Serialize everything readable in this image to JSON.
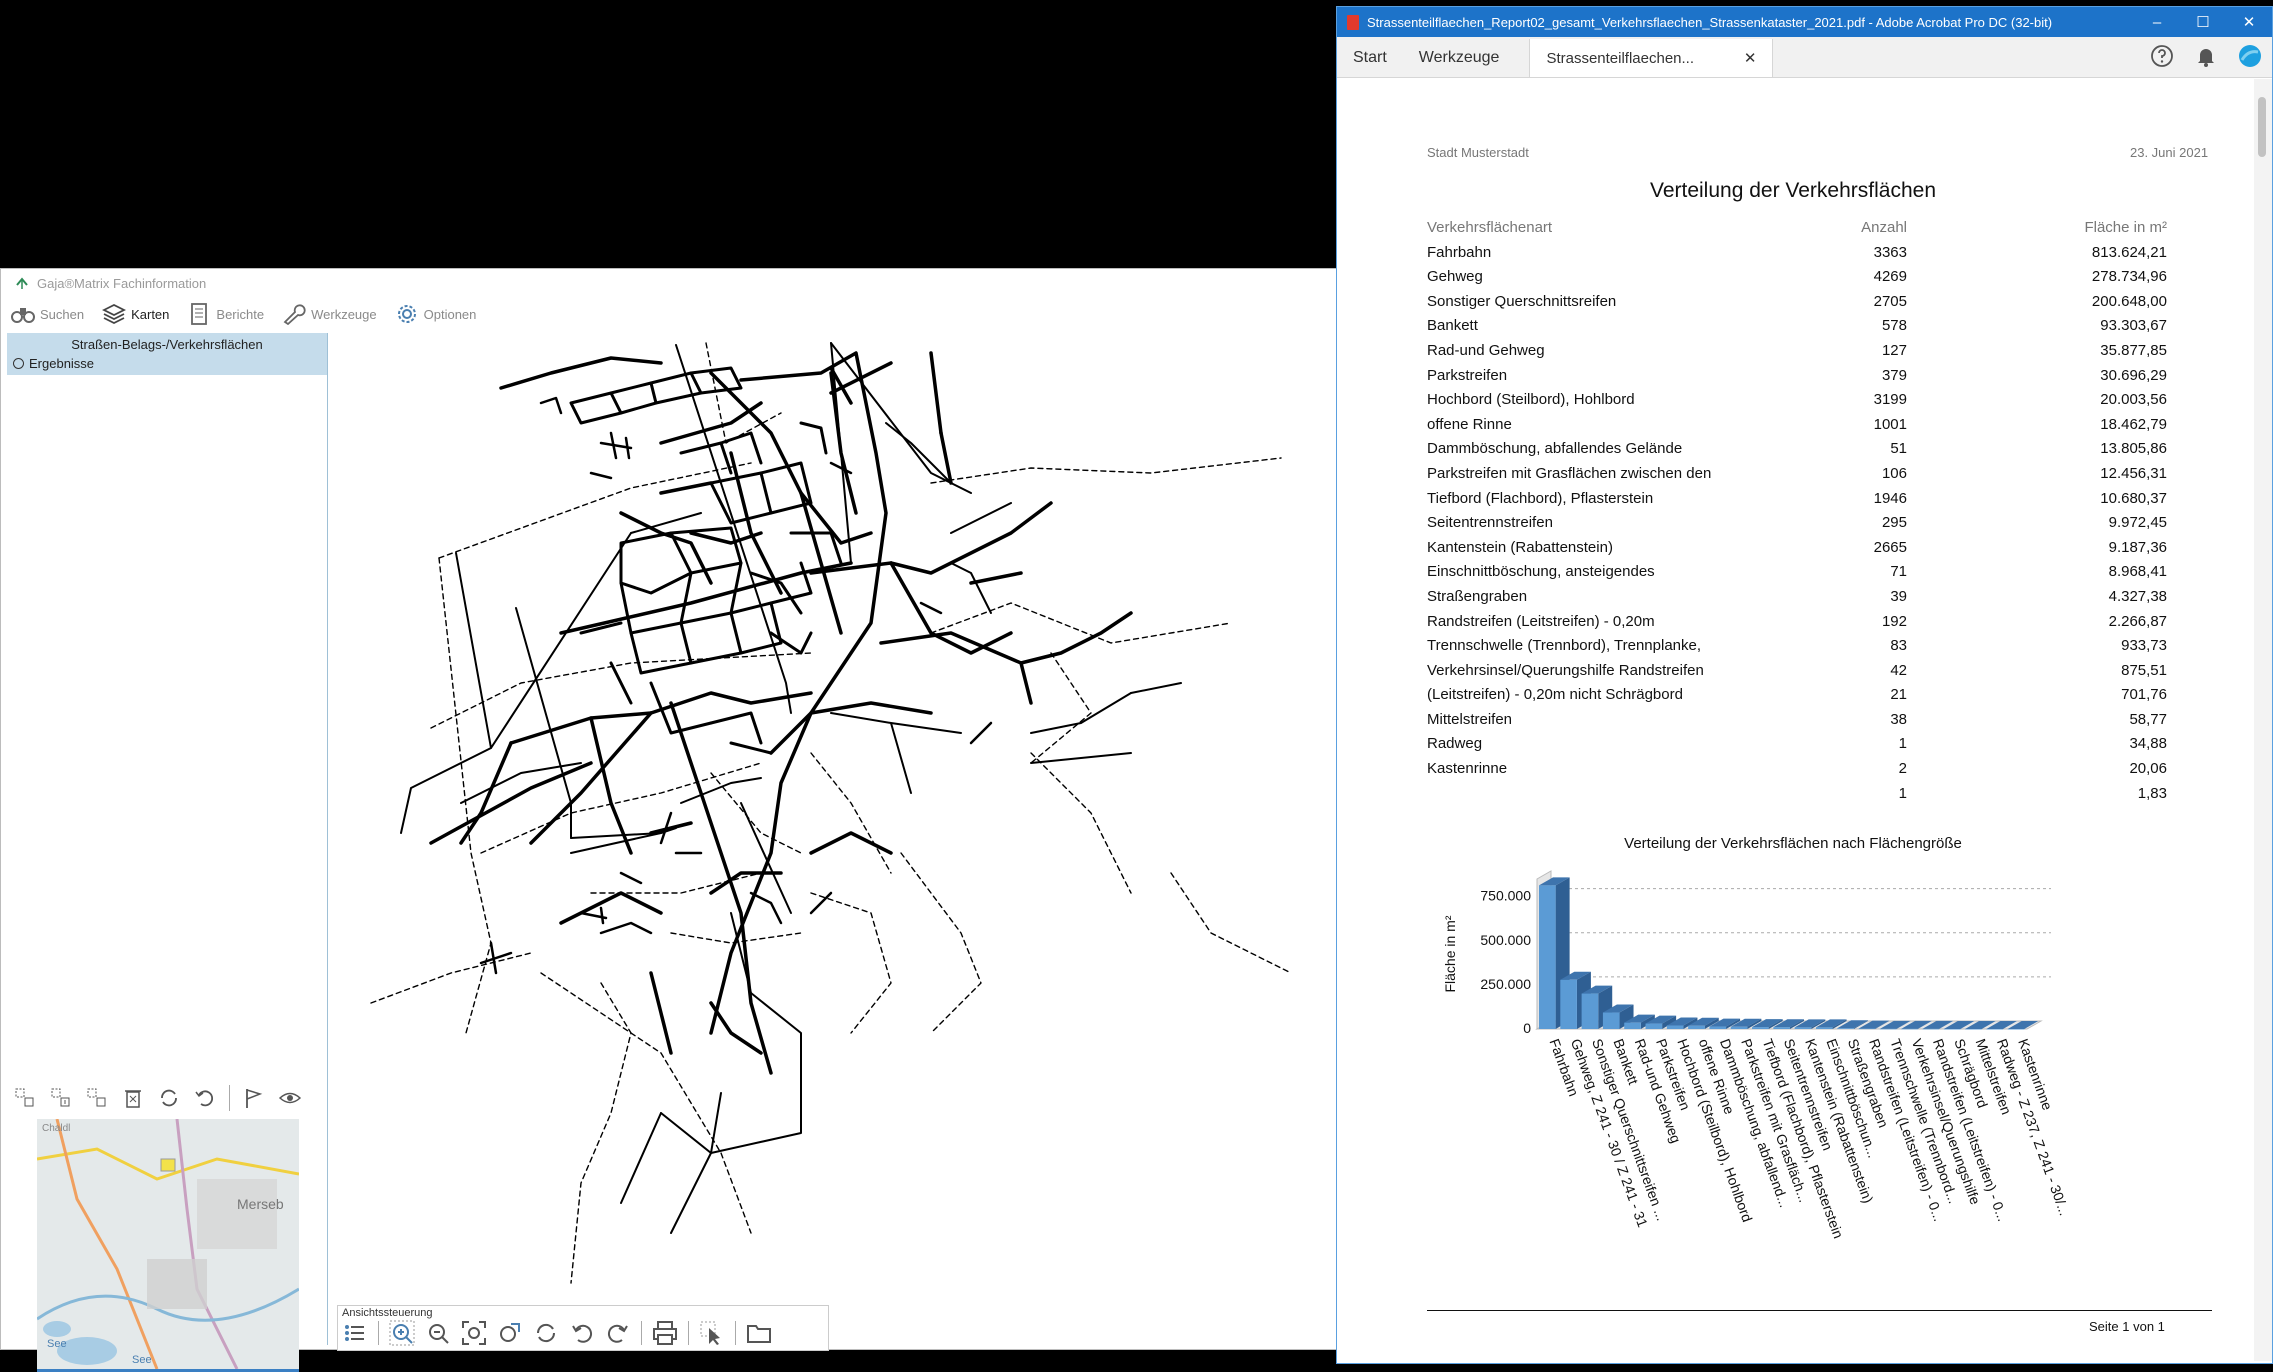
{
  "gis": {
    "title": "Gaja®Matrix Fachinformation",
    "toolbar": [
      {
        "label": "Suchen",
        "icon": "binoculars-icon"
      },
      {
        "label": "Karten",
        "icon": "layers-icon"
      },
      {
        "label": "Berichte",
        "icon": "report-icon"
      },
      {
        "label": "Werkzeuge",
        "icon": "wrench-icon"
      },
      {
        "label": "Optionen",
        "icon": "gear-icon"
      }
    ],
    "sidebar": {
      "header": "Straßen-Belags-/Verkehrsflächen",
      "item": "Ergebnisse"
    },
    "overview_labels": {
      "town": "Merseb",
      "lake": "See",
      "lake2": "See",
      "top": "Chaldl"
    },
    "view_control_label": "Ansichtssteuerung"
  },
  "acrobat": {
    "title": "Strassenteilflaechen_Report02_gesamt_Verkehrsflaechen_Strassenkataster_2021.pdf - Adobe Acrobat Pro DC (32-bit)",
    "tabs": {
      "start": "Start",
      "tools": "Werkzeuge",
      "doc": "Strassenteilflaechen..."
    },
    "window_buttons": {
      "minimize": "–",
      "maximize": "☐",
      "close": "✕"
    }
  },
  "report": {
    "city": "Stadt Musterstadt",
    "date": "23. Juni 2021",
    "title": "Verteilung der Verkehrsflächen",
    "columns": {
      "type": "Verkehrsflächenart",
      "count": "Anzahl",
      "area": "Fläche in m²"
    },
    "rows": [
      {
        "type": "Fahrbahn",
        "count": "3363",
        "area": "813.624,21"
      },
      {
        "type": "Gehweg",
        "count": "4269",
        "area": "278.734,96"
      },
      {
        "type": "Sonstiger Querschnittsreifen",
        "count": "2705",
        "area": "200.648,00"
      },
      {
        "type": "Bankett",
        "count": "578",
        "area": "93.303,67"
      },
      {
        "type": "Rad-und Gehweg",
        "count": "127",
        "area": "35.877,85"
      },
      {
        "type": "Parkstreifen",
        "count": "379",
        "area": "30.696,29"
      },
      {
        "type": "Hochbord (Steilbord), Hohlbord",
        "count": "3199",
        "area": "20.003,56"
      },
      {
        "type": "offene Rinne",
        "count": "1001",
        "area": "18.462,79"
      },
      {
        "type": "Dammböschung, abfallendes Gelände",
        "count": "51",
        "area": "13.805,86"
      },
      {
        "type": "Parkstreifen mit Grasflächen zwischen den",
        "count": "106",
        "area": "12.456,31"
      },
      {
        "type": "Tiefbord (Flachbord), Pflasterstein",
        "count": "1946",
        "area": "10.680,37"
      },
      {
        "type": "Seitentrennstreifen",
        "count": "295",
        "area": "9.972,45"
      },
      {
        "type": "Kantenstein (Rabattenstein)",
        "count": "2665",
        "area": "9.187,36"
      },
      {
        "type": "Einschnittböschung, ansteigendes",
        "count": "71",
        "area": "8.968,41"
      },
      {
        "type": "Straßengraben",
        "count": "39",
        "area": "4.327,38"
      },
      {
        "type": "Randstreifen (Leitstreifen) - 0,20m",
        "count": "192",
        "area": "2.266,87"
      },
      {
        "type": "Trennschwelle (Trennbord), Trennplanke,",
        "count": "83",
        "area": "933,73"
      },
      {
        "type": "Verkehrsinsel/Querungshilfe Randstreifen",
        "count": "42",
        "area": "875,51"
      },
      {
        "type": "(Leitstreifen) - 0,20m nicht Schrägbord",
        "count": "21",
        "area": "701,76"
      },
      {
        "type": "Mittelstreifen",
        "count": "38",
        "area": "58,77"
      },
      {
        "type": "Radweg",
        "count": "1",
        "area": "34,88"
      },
      {
        "type": "Kastenrinne",
        "count": "2",
        "area": "20,06"
      },
      {
        "type": "",
        "count": "1",
        "area": "1,83"
      }
    ],
    "footer": "Seite 1 von  1"
  },
  "chart_data": {
    "type": "bar",
    "title": "Verteilung der Verkehrsflächen nach Flächengröße",
    "xlabel": "",
    "ylabel": "Fläche in m²",
    "ylim": [
      0,
      850000
    ],
    "yticks": [
      "0",
      "250.000",
      "500.000",
      "750.000"
    ],
    "ytick_values": [
      0,
      250000,
      500000,
      750000
    ],
    "grid": true,
    "categories": [
      "Fahrbahn",
      "Gehweg, Z 241 - 30 / Z 241 - 31",
      "Sonstiger Querschnittsreifen ...",
      "Bankett",
      "Rad-und Gehweg",
      "Parkstreifen",
      "Hochbord (Steilbord), Hohlbord",
      "offene Rinne",
      "Dammböschung, abfallend...",
      "Parkstreifen mit Grasfläch...",
      "Tiefbord (Flachbord), Pflasterstein",
      "Seitentrennstreifen",
      "Kantenstein (Rabattenstein)",
      "Einschnittböschun...",
      "Straßengraben",
      "Randstreifen (Leitstreifen) - 0...",
      "Trennschwelle (Trennbord...",
      "Verkehrsinsel/Querungshilfe",
      "Randstreifen (Leitstreifen) - 0...",
      "Schrägbord",
      "Mittelstreifen",
      "Radweg - Z 237, Z 241 - 30/...",
      "Kastenrinne"
    ],
    "values": [
      813624.21,
      278734.96,
      200648.0,
      93303.67,
      35877.85,
      30696.29,
      20003.56,
      18462.79,
      13805.86,
      12456.31,
      10680.37,
      9972.45,
      9187.36,
      8968.41,
      4327.38,
      2266.87,
      933.73,
      875.51,
      701.76,
      58.77,
      34.88,
      20.06,
      1.83
    ],
    "colors": {
      "front": "#5b9bd5",
      "side": "#2f5f93",
      "top": "#3e74ad"
    }
  }
}
